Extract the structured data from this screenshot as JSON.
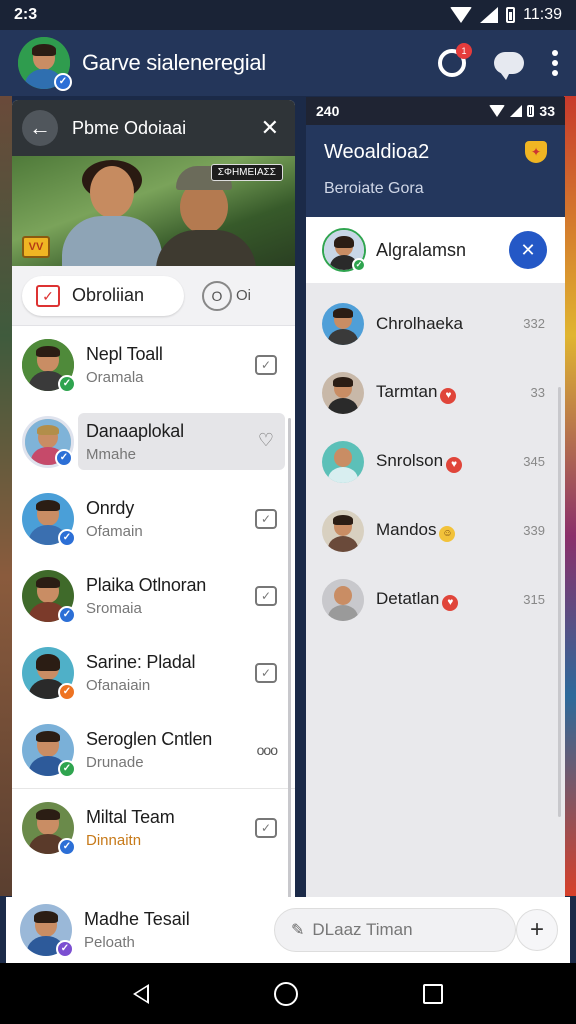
{
  "status_bar": {
    "time_left": "2:3",
    "time_right": "11:39"
  },
  "app_bar": {
    "title": "Garve sialeneregial",
    "notification_count": "1"
  },
  "left_panel": {
    "title": "Pbme Odoiaai",
    "hero_tag": "ΣΦΗΜΕΙΑΣΣ",
    "hero_corner": "VV",
    "filter_label": "Obroliian",
    "filter_other_a": "O",
    "filter_other_b": "Oi",
    "contacts": [
      {
        "name": "Nepl Toall",
        "sub": "Oramala",
        "badge": "green",
        "shirt": "#3a3a3a"
      },
      {
        "name": "Danaaplokal",
        "sub": "Mmahe",
        "badge": "blue",
        "shirt": "#c64a6a",
        "selected": true
      },
      {
        "name": "Onrdy",
        "sub": "Ofamain",
        "badge": "blue",
        "shirt": "#3a6fb0"
      },
      {
        "name": "Plaika Otlnoran",
        "sub": "Sromaia",
        "badge": "blue",
        "shirt": "#7b3a2a"
      },
      {
        "name": "Sarine: Pladal",
        "sub": "Ofanaiain",
        "badge": "orange",
        "shirt": "#2a2a2a"
      },
      {
        "name": "Seroglen Cntlen",
        "sub": "Drunade",
        "badge": "green",
        "shirt": "#2d5a9a"
      },
      {
        "name": "Miltal Team",
        "sub": "Dinnaitn",
        "badge": "blue",
        "shirt": "#5a3a2a"
      }
    ]
  },
  "right_panel": {
    "status_time": "240",
    "status_right": "33",
    "title": "Weoaldioa2",
    "subtitle": "Beroiate Gora",
    "selected_name": "Algralamsn",
    "items": [
      {
        "name": "Chrolhaeka",
        "count": "332",
        "emoji": ""
      },
      {
        "name": "Tarmtan",
        "count": "33",
        "emoji": "red"
      },
      {
        "name": "Snrolson",
        "count": "345",
        "emoji": "red"
      },
      {
        "name": "Mandos",
        "count": "339",
        "emoji": "yellow"
      },
      {
        "name": "Detatlan",
        "count": "315",
        "emoji": "red"
      }
    ]
  },
  "bottom_bar": {
    "name": "Madhe Tesail",
    "sub": "Peloath",
    "compose_placeholder": "DLaaz Timan"
  },
  "icons": {
    "back": "arrow-left-icon",
    "close": "close-icon",
    "more": "more-vert-icon",
    "chat": "chat-bubble-icon",
    "notifications": "ring-icon",
    "compose": "pencil-icon",
    "add": "plus-icon"
  },
  "colors": {
    "app_bar": "#24365a",
    "selected_go": "#2458c6",
    "badge_blue": "#2c6fd6",
    "badge_green": "#2fa44f"
  }
}
